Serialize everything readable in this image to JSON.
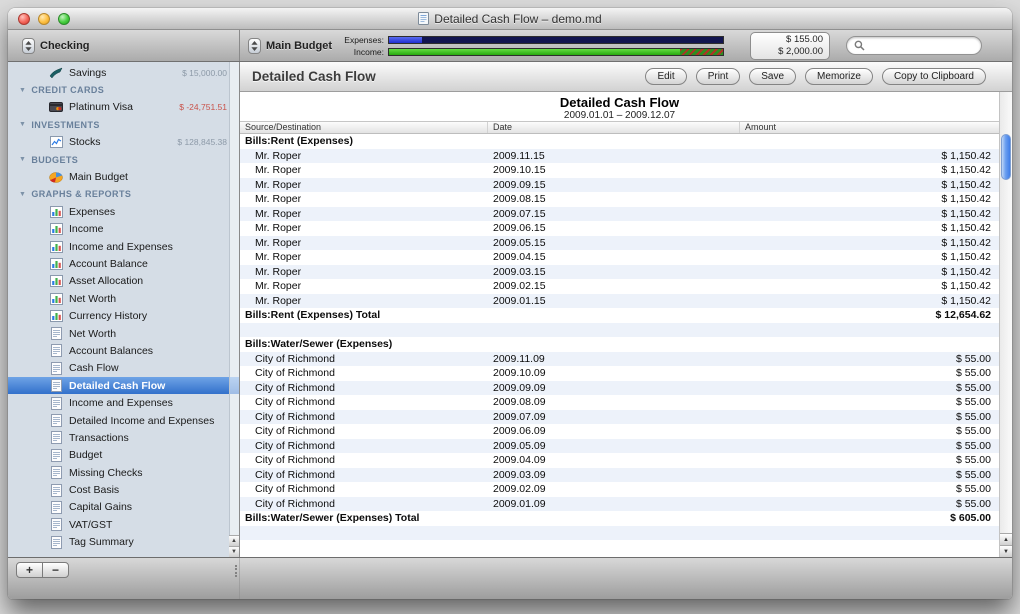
{
  "window": {
    "title": "Detailed Cash Flow – demo.md"
  },
  "toolbar": {
    "account_selector": "Checking",
    "budget_selector": "Main Budget",
    "expenses_label": "Expenses:",
    "income_label": "Income:",
    "expenses_total": "$ 155.00",
    "income_total": "$ 2,000.00",
    "expenses_bar_pct": 10,
    "income_bar_pct": 87,
    "income_hatch_pct": 13,
    "search_value": ""
  },
  "colors": {
    "selection_blue": "#3270cb",
    "row_alternate": "#edf2fa",
    "expenses_fill": "#2a36e0",
    "income_fill": "#2fb913",
    "negative_value": "#c9534b"
  },
  "sidebar": {
    "entries": [
      {
        "kind": "item",
        "icon": "savings-icon",
        "label": "Savings",
        "value": "$ 15,000.00"
      },
      {
        "kind": "header",
        "label": "CREDIT CARDS"
      },
      {
        "kind": "item",
        "icon": "credit-card-icon",
        "label": "Platinum Visa",
        "value": "$ -24,751.51",
        "negative": true
      },
      {
        "kind": "header",
        "label": "INVESTMENTS"
      },
      {
        "kind": "item",
        "icon": "stocks-icon",
        "label": "Stocks",
        "value": "$ 128,845.38"
      },
      {
        "kind": "header",
        "label": "BUDGETS"
      },
      {
        "kind": "item",
        "icon": "budget-icon",
        "label": "Main Budget"
      },
      {
        "kind": "header",
        "label": "GRAPHS & REPORTS"
      },
      {
        "kind": "item",
        "icon": "chart-icon",
        "label": "Expenses"
      },
      {
        "kind": "item",
        "icon": "chart-icon",
        "label": "Income"
      },
      {
        "kind": "item",
        "icon": "chart-icon",
        "label": "Income and Expenses"
      },
      {
        "kind": "item",
        "icon": "chart-icon",
        "label": "Account Balance"
      },
      {
        "kind": "item",
        "icon": "chart-icon",
        "label": "Asset Allocation"
      },
      {
        "kind": "item",
        "icon": "chart-icon",
        "label": "Net Worth"
      },
      {
        "kind": "item",
        "icon": "chart-icon",
        "label": "Currency History"
      },
      {
        "kind": "item",
        "icon": "report-icon",
        "label": "Net Worth"
      },
      {
        "kind": "item",
        "icon": "report-icon",
        "label": "Account Balances"
      },
      {
        "kind": "item",
        "icon": "report-icon",
        "label": "Cash Flow"
      },
      {
        "kind": "item",
        "icon": "report-icon",
        "label": "Detailed Cash Flow",
        "selected": true
      },
      {
        "kind": "item",
        "icon": "report-icon",
        "label": "Income and Expenses"
      },
      {
        "kind": "item",
        "icon": "report-icon",
        "label": "Detailed Income and Expenses"
      },
      {
        "kind": "item",
        "icon": "report-icon",
        "label": "Transactions"
      },
      {
        "kind": "item",
        "icon": "report-icon",
        "label": "Budget"
      },
      {
        "kind": "item",
        "icon": "report-icon",
        "label": "Missing Checks"
      },
      {
        "kind": "item",
        "icon": "report-icon",
        "label": "Cost Basis"
      },
      {
        "kind": "item",
        "icon": "report-icon",
        "label": "Capital Gains"
      },
      {
        "kind": "item",
        "icon": "report-icon",
        "label": "VAT/GST"
      },
      {
        "kind": "item",
        "icon": "report-icon",
        "label": "Tag Summary"
      }
    ]
  },
  "report_bar": {
    "title": "Detailed Cash Flow",
    "buttons": [
      "Edit",
      "Print",
      "Save",
      "Memorize",
      "Copy to Clipboard"
    ]
  },
  "bottom_bar": {
    "add_label": "+",
    "remove_label": "−"
  },
  "report": {
    "title": "Detailed Cash Flow",
    "date_range": "2009.01.01 – 2009.12.07",
    "columns": [
      "Source/Destination",
      "Date",
      "Amount"
    ],
    "rows": [
      {
        "type": "group",
        "source": "Bills:Rent (Expenses)"
      },
      {
        "type": "data",
        "source": "Mr. Roper",
        "date": "2009.11.15",
        "amount": "$ 1,150.42"
      },
      {
        "type": "data",
        "source": "Mr. Roper",
        "date": "2009.10.15",
        "amount": "$ 1,150.42"
      },
      {
        "type": "data",
        "source": "Mr. Roper",
        "date": "2009.09.15",
        "amount": "$ 1,150.42"
      },
      {
        "type": "data",
        "source": "Mr. Roper",
        "date": "2009.08.15",
        "amount": "$ 1,150.42"
      },
      {
        "type": "data",
        "source": "Mr. Roper",
        "date": "2009.07.15",
        "amount": "$ 1,150.42"
      },
      {
        "type": "data",
        "source": "Mr. Roper",
        "date": "2009.06.15",
        "amount": "$ 1,150.42"
      },
      {
        "type": "data",
        "source": "Mr. Roper",
        "date": "2009.05.15",
        "amount": "$ 1,150.42"
      },
      {
        "type": "data",
        "source": "Mr. Roper",
        "date": "2009.04.15",
        "amount": "$ 1,150.42"
      },
      {
        "type": "data",
        "source": "Mr. Roper",
        "date": "2009.03.15",
        "amount": "$ 1,150.42"
      },
      {
        "type": "data",
        "source": "Mr. Roper",
        "date": "2009.02.15",
        "amount": "$ 1,150.42"
      },
      {
        "type": "data",
        "source": "Mr. Roper",
        "date": "2009.01.15",
        "amount": "$ 1,150.42"
      },
      {
        "type": "total",
        "source": "Bills:Rent (Expenses) Total",
        "amount": "$ 12,654.62"
      },
      {
        "type": "blank"
      },
      {
        "type": "group",
        "source": "Bills:Water/Sewer (Expenses)"
      },
      {
        "type": "data",
        "source": "City of Richmond",
        "date": "2009.11.09",
        "amount": "$ 55.00"
      },
      {
        "type": "data",
        "source": "City of Richmond",
        "date": "2009.10.09",
        "amount": "$ 55.00"
      },
      {
        "type": "data",
        "source": "City of Richmond",
        "date": "2009.09.09",
        "amount": "$ 55.00"
      },
      {
        "type": "data",
        "source": "City of Richmond",
        "date": "2009.08.09",
        "amount": "$ 55.00"
      },
      {
        "type": "data",
        "source": "City of Richmond",
        "date": "2009.07.09",
        "amount": "$ 55.00"
      },
      {
        "type": "data",
        "source": "City of Richmond",
        "date": "2009.06.09",
        "amount": "$ 55.00"
      },
      {
        "type": "data",
        "source": "City of Richmond",
        "date": "2009.05.09",
        "amount": "$ 55.00"
      },
      {
        "type": "data",
        "source": "City of Richmond",
        "date": "2009.04.09",
        "amount": "$ 55.00"
      },
      {
        "type": "data",
        "source": "City of Richmond",
        "date": "2009.03.09",
        "amount": "$ 55.00"
      },
      {
        "type": "data",
        "source": "City of Richmond",
        "date": "2009.02.09",
        "amount": "$ 55.00"
      },
      {
        "type": "data",
        "source": "City of Richmond",
        "date": "2009.01.09",
        "amount": "$ 55.00"
      },
      {
        "type": "total",
        "source": "Bills:Water/Sewer (Expenses) Total",
        "amount": "$ 605.00"
      },
      {
        "type": "blank"
      },
      {
        "type": "blank"
      }
    ]
  }
}
